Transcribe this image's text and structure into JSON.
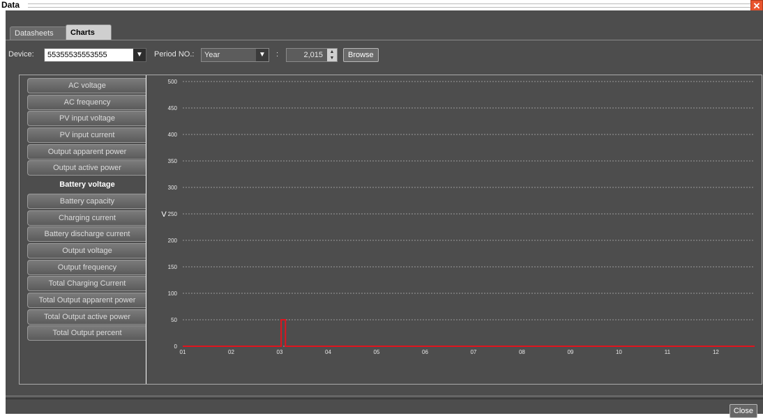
{
  "window": {
    "title": "Data"
  },
  "tabs": [
    {
      "label": "Datasheets",
      "selected": false
    },
    {
      "label": "Charts",
      "selected": true
    }
  ],
  "toolbar": {
    "device_label": "Device:",
    "device_value": "55355535553555",
    "period_label": "Period NO.:",
    "period_value": "Year",
    "separator": ":",
    "year_value": "2,015",
    "browse_label": "Browse"
  },
  "sidebar": {
    "items": [
      {
        "label": "AC voltage",
        "selected": false
      },
      {
        "label": "AC frequency",
        "selected": false
      },
      {
        "label": "PV input voltage",
        "selected": false
      },
      {
        "label": "PV input current",
        "selected": false
      },
      {
        "label": "Output apparent power",
        "selected": false
      },
      {
        "label": "Output active power",
        "selected": false
      },
      {
        "label": "Battery voltage",
        "selected": true
      },
      {
        "label": "Battery capacity",
        "selected": false
      },
      {
        "label": "Charging current",
        "selected": false
      },
      {
        "label": "Battery discharge current",
        "selected": false
      },
      {
        "label": "Output voltage",
        "selected": false
      },
      {
        "label": "Output frequency",
        "selected": false
      },
      {
        "label": "Total Charging Current",
        "selected": false
      },
      {
        "label": "Total Output apparent power",
        "selected": false
      },
      {
        "label": "Total Output active power",
        "selected": false
      },
      {
        "label": "Total Output percent",
        "selected": false
      }
    ]
  },
  "chart_data": {
    "type": "line",
    "title": "",
    "xlabel": "",
    "ylabel": "V",
    "categories": [
      "01",
      "02",
      "03",
      "04",
      "05",
      "06",
      "07",
      "08",
      "09",
      "10",
      "11",
      "12"
    ],
    "x_range": [
      1,
      12.8
    ],
    "ylim": [
      0,
      500
    ],
    "yticks": [
      0,
      50,
      100,
      150,
      200,
      250,
      300,
      350,
      400,
      450,
      500
    ],
    "grid": true,
    "series": [
      {
        "color": "#e0141e",
        "points": [
          [
            1,
            0
          ],
          [
            3.03,
            0
          ],
          [
            3.03,
            50
          ],
          [
            3.12,
            50
          ],
          [
            3.12,
            0
          ],
          [
            12.8,
            0
          ]
        ]
      }
    ]
  },
  "footer": {
    "close_label": "Close"
  },
  "colors": {
    "panel_bg": "#4d4d4d",
    "series_red": "#e0141e",
    "close_red": "#e8542e"
  }
}
